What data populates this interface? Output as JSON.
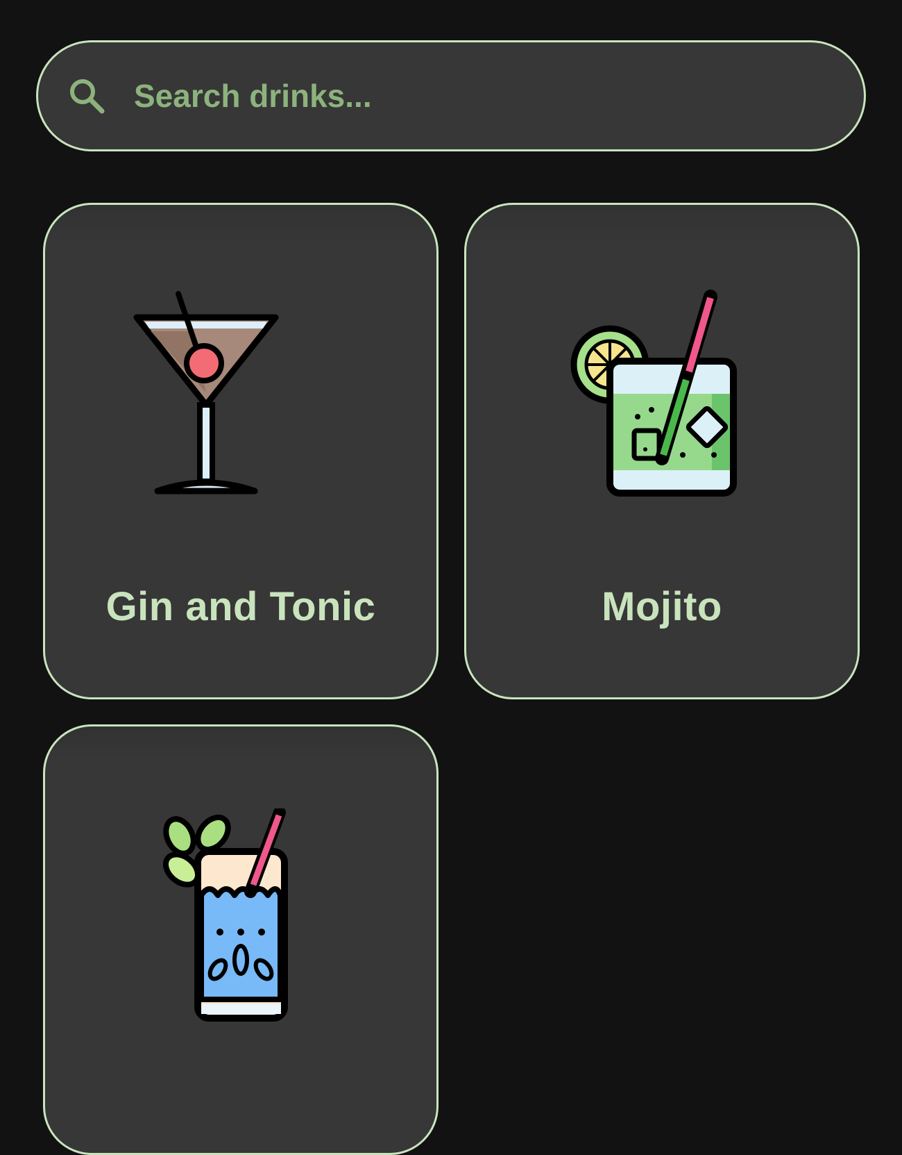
{
  "search": {
    "placeholder": "Search drinks...",
    "value": "",
    "icon": "search-icon"
  },
  "drinks": [
    {
      "label": "Gin and Tonic",
      "icon": "martini-glass-icon"
    },
    {
      "label": "Mojito",
      "icon": "lime-cocktail-icon"
    },
    {
      "label": "",
      "icon": "blue-cocktail-icon"
    }
  ],
  "colors": {
    "background": "#121212",
    "card_background": "#373737",
    "accent_border": "#c9e4bd",
    "label_text": "#c9e4bd",
    "placeholder_text": "#8db37d"
  }
}
